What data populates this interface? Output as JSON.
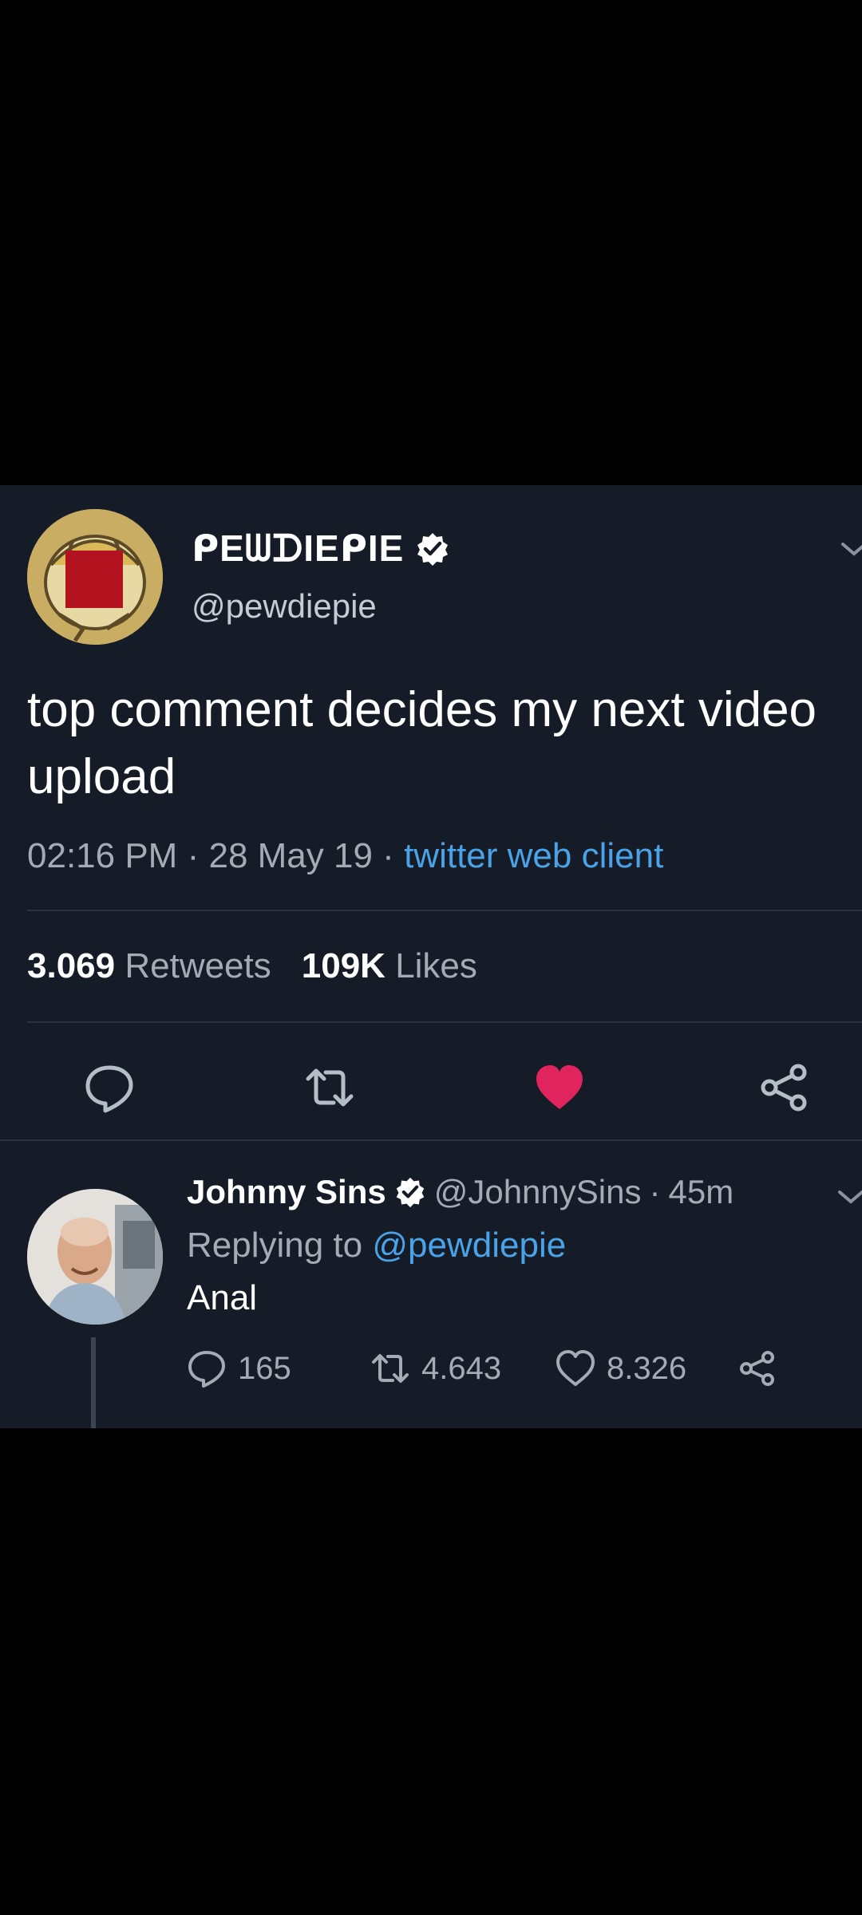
{
  "main_tweet": {
    "display_name": "ᑭEᗯᗪIEᑭIE",
    "handle": "@pewdiepie",
    "text": "top comment decides my next video upload",
    "time": "02:16 PM",
    "date": "28 May 19",
    "separator": "·",
    "client": "twitter web client",
    "retweets_count": "3.069",
    "retweets_label": "Retweets",
    "likes_count": "109K",
    "likes_label": "Likes",
    "liked": true
  },
  "reply_tweet": {
    "display_name": "Johnny Sins",
    "handle": "@JohnnySins",
    "age": "45m",
    "replying_prefix": "Replying to",
    "replying_to": "@pewdiepie",
    "text": "Anal",
    "reply_count": "165",
    "retweet_count": "4.643",
    "like_count": "8.326"
  },
  "colors": {
    "background": "#000000",
    "card": "#151c27",
    "accent_link": "#4aa3e8",
    "like_active": "#e0245e",
    "muted_text": "#a3abb4",
    "verified": "#ffffff"
  },
  "icons": {
    "verified": "verified-badge-icon",
    "chevron": "chevron-down-icon",
    "reply": "reply-icon",
    "retweet": "retweet-icon",
    "like": "heart-icon",
    "share": "share-icon"
  }
}
